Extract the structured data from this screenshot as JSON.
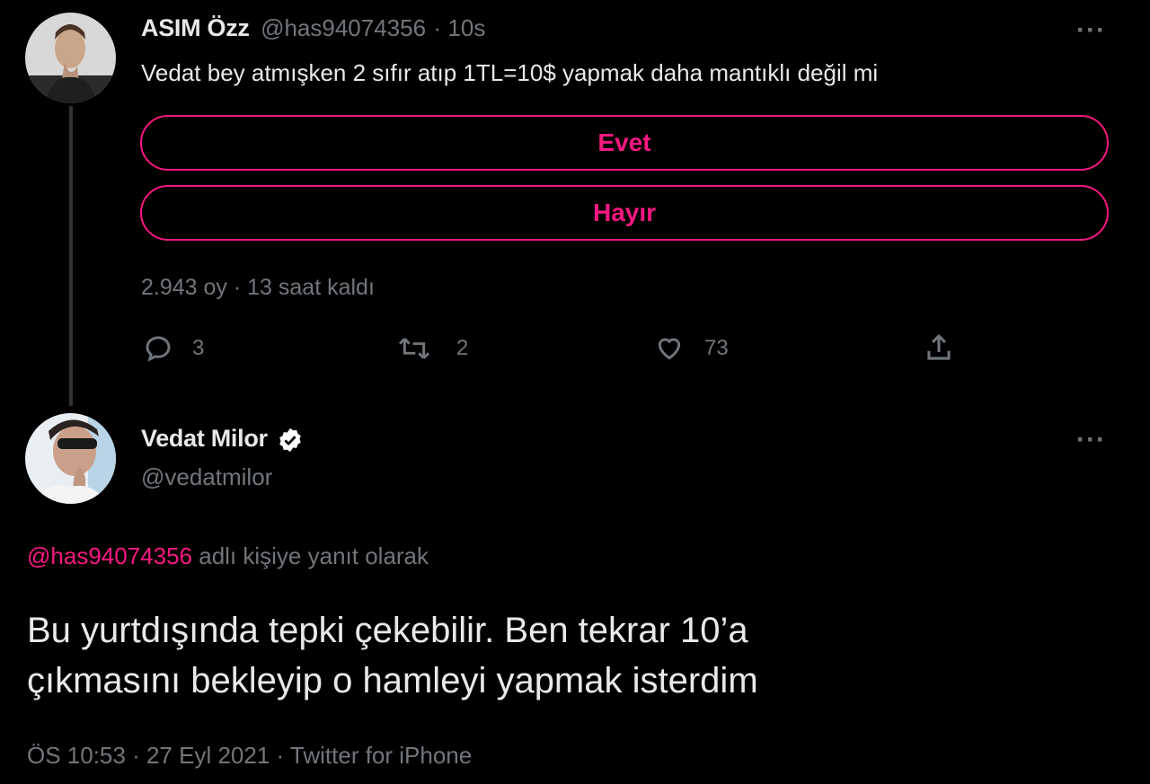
{
  "tweet1": {
    "name": "ASIM Özz",
    "handle": "@has94074356",
    "time": "· 10s",
    "text": "Vedat bey atmışken 2 sıfır atıp 1TL=10$ yapmak daha mantıklı değil mi",
    "poll": {
      "options": [
        "Evet",
        "Hayır"
      ],
      "votes": "2.943 oy",
      "remaining": "· 13 saat kaldı"
    },
    "actions": {
      "reply": "3",
      "retweet": "2",
      "like": "73"
    },
    "more": "···"
  },
  "tweet2": {
    "name": "Vedat Milor",
    "handle": "@vedatmilor",
    "reply_mention": "@has94074356",
    "reply_suffix": "adlı kişiye yanıt olarak",
    "text_line1": "Bu yurtdışında tepki çekebilir. Ben tekrar 10’a",
    "text_line2": "çıkmasını bekleyip o hamleyi yapmak isterdim",
    "meta": "ÖS 10:53 · 27 Eyl 2021 · Twitter for iPhone",
    "more": "···"
  },
  "colors": {
    "accent": "#f91880",
    "muted": "#71767b",
    "text": "#e7e9ea",
    "background": "#000000",
    "verified": "#ffffff"
  },
  "icons": [
    "reply-icon",
    "retweet-icon",
    "like-icon",
    "share-icon",
    "verified-icon",
    "more-icon"
  ]
}
